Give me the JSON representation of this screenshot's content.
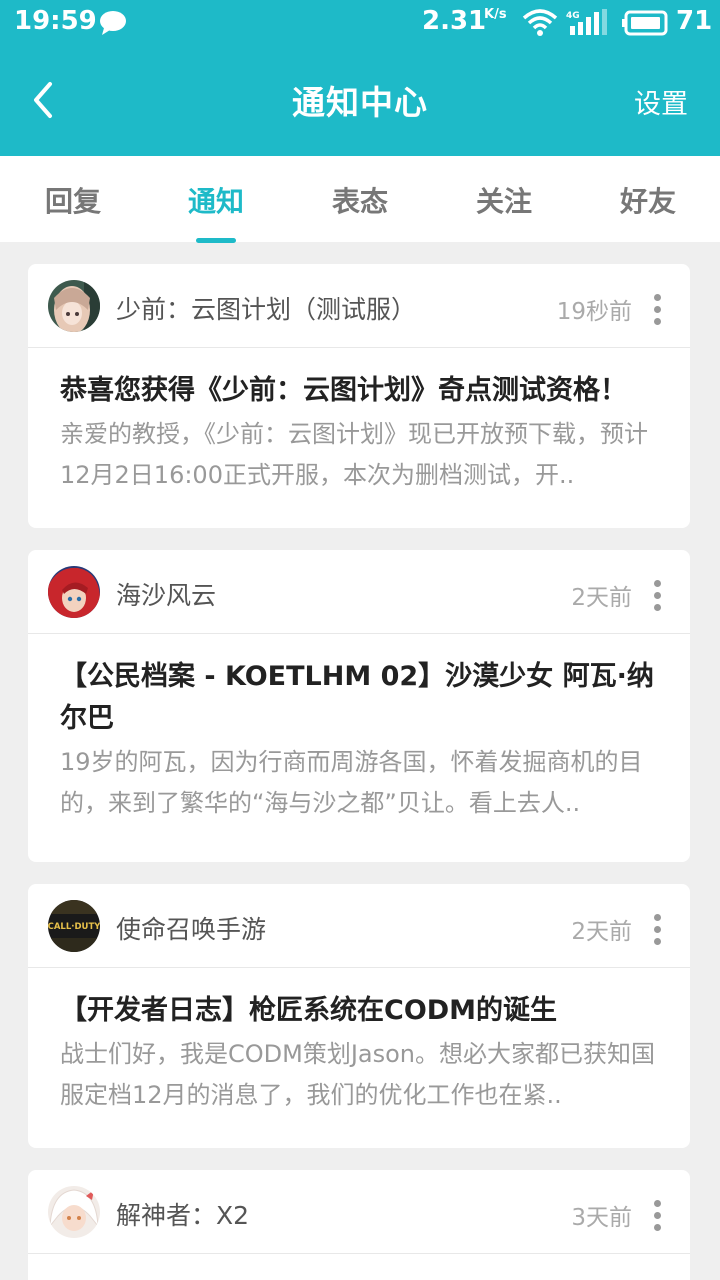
{
  "status": {
    "time": "19:59",
    "speed": "2.31",
    "speed_unit": "K/s",
    "network": "4G",
    "battery": "71"
  },
  "header": {
    "title": "通知中心",
    "settings_label": "设置"
  },
  "tabs": [
    {
      "label": "回复"
    },
    {
      "label": "通知"
    },
    {
      "label": "表态"
    },
    {
      "label": "关注"
    },
    {
      "label": "好友"
    }
  ],
  "active_tab": "通知",
  "colors": {
    "accent": "#1ebac8",
    "background": "#efefef"
  },
  "notifications": [
    {
      "source": "少前：云图计划（测试服）",
      "time": "19秒前",
      "title": "恭喜您获得《少前：云图计划》奇点测试资格！",
      "excerpt": "亲爱的教授，《少前：云图计划》现已开放预下载，预计12月2日16:00正式开服，本次为删档测试，开..",
      "avatar": "anime-girl-avatar"
    },
    {
      "source": "海沙风云",
      "time": "2天前",
      "title": "【公民档案 - KOETLHM 02】沙漠少女 阿瓦·纳尔巴",
      "excerpt": "19岁的阿瓦，因为行商而周游各国，怀着发掘商机的目的，来到了繁华的“海与沙之都”贝让。看上去人..",
      "avatar": "red-hair-avatar"
    },
    {
      "source": "使命召唤手游",
      "time": "2天前",
      "title": "【开发者日志】枪匠系统在CODM的诞生",
      "excerpt": "战士们好，我是CODM策划Jason。想必大家都已获知国服定档12月的消息了，我们的优化工作也在紧..",
      "avatar": "call-of-duty-logo",
      "avatar_text": "CALL·DUTY"
    },
    {
      "source": "解神者：X2",
      "time": "3天前",
      "title": "",
      "excerpt": "",
      "avatar": "white-hair-avatar"
    }
  ]
}
